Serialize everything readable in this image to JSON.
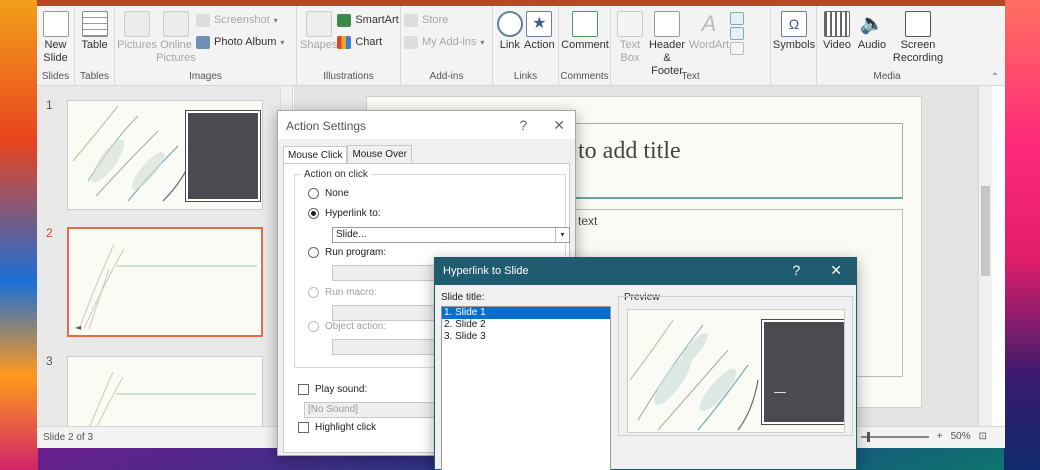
{
  "ribbon": {
    "groups": [
      {
        "label": "Slides"
      },
      {
        "label": "Tables"
      },
      {
        "label": "Images"
      },
      {
        "label": "Illustrations"
      },
      {
        "label": "Add-ins"
      },
      {
        "label": "Links"
      },
      {
        "label": "Comments"
      },
      {
        "label": "Text"
      },
      {
        "label": "Media"
      }
    ],
    "new_slide": "New\nSlide",
    "table": "Table",
    "pictures": "Pictures",
    "online_pictures": "Online\nPictures",
    "screenshot": "Screenshot",
    "photo_album": "Photo Album",
    "shapes": "Shapes",
    "smartart": "SmartArt",
    "chart": "Chart",
    "store": "Store",
    "my_addins": "My Add-ins",
    "link": "Link",
    "action": "Action",
    "comment": "Comment",
    "text_box": "Text\nBox",
    "header_footer": "Header\n& Footer",
    "wordart": "WordArt",
    "symbols": "Symbols",
    "video": "Video",
    "audio": "Audio",
    "screen_recording": "Screen\nRecording"
  },
  "thumbnails": [
    {
      "num": "1"
    },
    {
      "num": "2"
    },
    {
      "num": "3"
    }
  ],
  "slide": {
    "title_placeholder": "to add title",
    "body_placeholder": "text"
  },
  "status": {
    "slide_counter": "Slide 2 of 3",
    "zoom": "50%"
  },
  "action_settings": {
    "title": "Action Settings",
    "help": "?",
    "close": "✕",
    "tabs": [
      "Mouse Click",
      "Mouse Over"
    ],
    "group_label": "Action on click",
    "none": "None",
    "hyperlink_to": "Hyperlink to:",
    "hyperlink_value": "Slide...",
    "run_program": "Run program:",
    "run_macro": "Run macro:",
    "object_action": "Object action:",
    "play_sound": "Play sound:",
    "sound_value": "[No Sound]",
    "highlight_click": "Highlight click"
  },
  "hyperlink_dialog": {
    "title": "Hyperlink to Slide",
    "help": "?",
    "close": "✕",
    "slide_title_label": "Slide title:",
    "preview_label": "Preview",
    "slides": [
      "1. Slide 1",
      "2. Slide 2",
      "3. Slide 3"
    ],
    "selected_index": 0
  },
  "colors": {
    "accent": "#b7472a",
    "dialog_header": "#1f5c6f",
    "selection": "#0a6ed1",
    "card": "#4a4b50"
  }
}
